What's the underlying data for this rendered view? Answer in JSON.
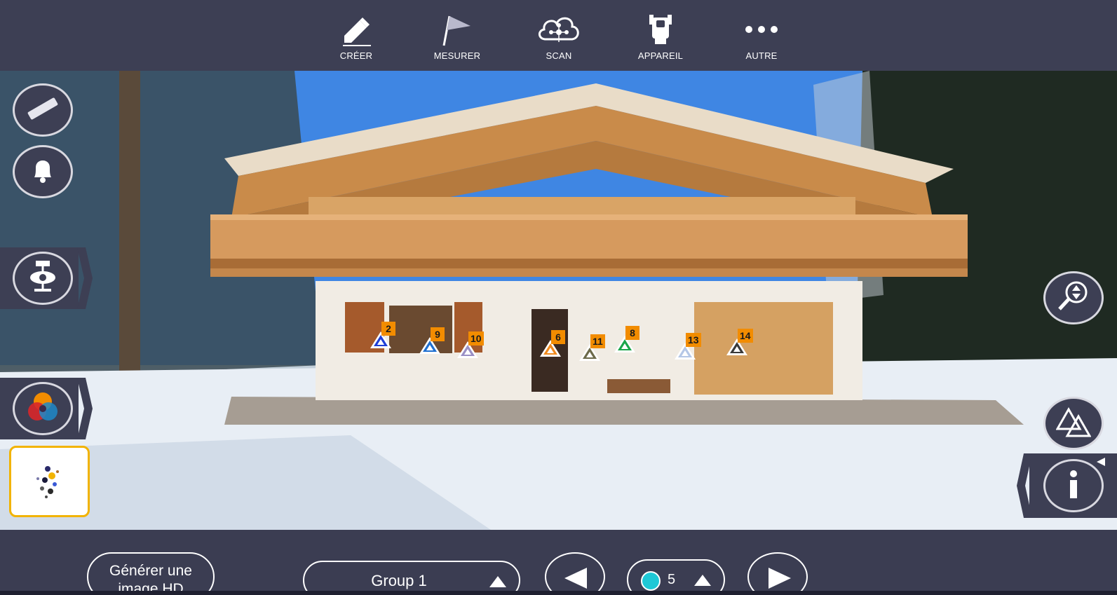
{
  "toolbar": {
    "items": [
      {
        "label": "CRÉER",
        "icon": "pencil-icon"
      },
      {
        "label": "MESURER",
        "icon": "flag-icon"
      },
      {
        "label": "SCAN",
        "icon": "cloud-network-icon"
      },
      {
        "label": "APPAREIL",
        "icon": "total-station-icon"
      },
      {
        "label": "AUTRE",
        "icon": "more-dots-icon"
      }
    ]
  },
  "left_panel": {
    "icons": [
      "ruler-icon",
      "bell-icon",
      "instrument-eye-icon",
      "color-circles-icon"
    ],
    "thumbnail_icon": "point-cloud-thumbnail"
  },
  "right_panel": {
    "icons": [
      "zoom-icon",
      "triangles-icon",
      "info-icon"
    ]
  },
  "markers": [
    {
      "label": "2",
      "color": "#1f3fd6"
    },
    {
      "label": "9",
      "color": "#1e6fd0"
    },
    {
      "label": "10",
      "color": "#9a8fc4"
    },
    {
      "label": "6",
      "color": "#f08a1e"
    },
    {
      "label": "11",
      "color": "#6c6a4a"
    },
    {
      "label": "8",
      "color": "#1aa64a"
    },
    {
      "label": "13",
      "color": "#b5c7e6"
    },
    {
      "label": "14",
      "color": "#3a3a3a"
    }
  ],
  "bottom": {
    "generate_label_line1": "Générer une",
    "generate_label_line2": "image HD",
    "group_label": "Group 1",
    "point_value": "5",
    "colors": {
      "point_dot": "#1ec8d6",
      "accent_thumb_border": "#f2b300",
      "marker_badge": "#f28c00"
    }
  }
}
